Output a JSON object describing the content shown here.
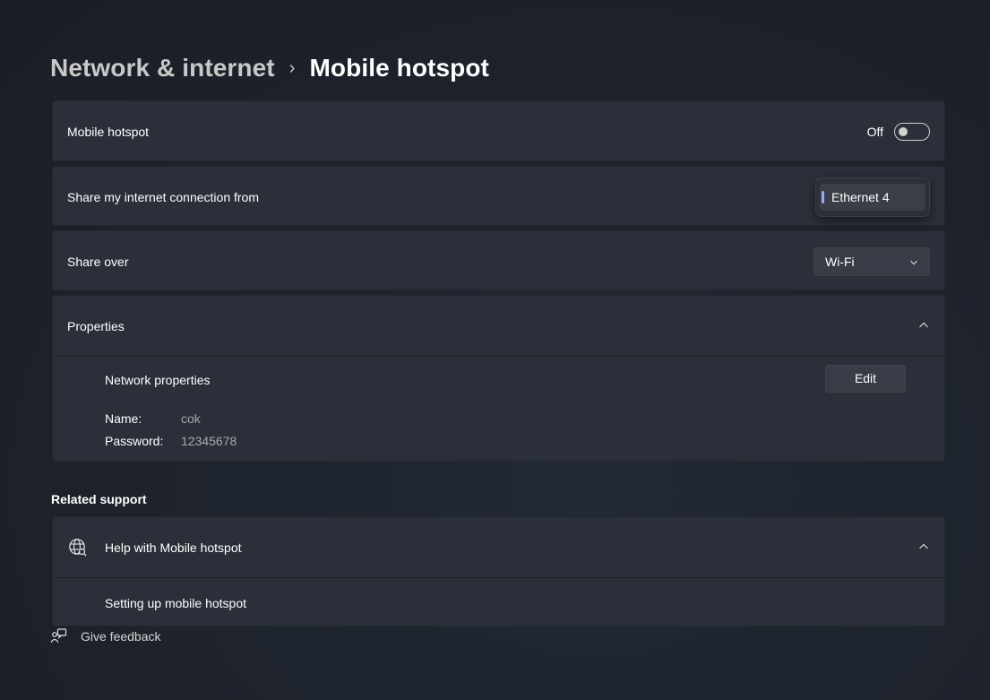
{
  "breadcrumb": {
    "parent": "Network & internet",
    "separator": "›",
    "current": "Mobile hotspot"
  },
  "hotspot": {
    "label": "Mobile hotspot",
    "state_label": "Off",
    "enabled": false
  },
  "share_from": {
    "label": "Share my internet connection from",
    "selected": "Ethernet 4"
  },
  "share_over": {
    "label": "Share over",
    "value": "Wi-Fi"
  },
  "properties": {
    "label": "Properties",
    "expanded": true,
    "network_properties_label": "Network properties",
    "edit_label": "Edit",
    "name_key": "Name:",
    "name_value": "cok",
    "password_key": "Password:",
    "password_value": "12345678"
  },
  "related_support": {
    "heading": "Related support",
    "help_label": "Help with Mobile hotspot",
    "expanded": true,
    "links": [
      "Setting up mobile hotspot"
    ]
  },
  "feedback": {
    "label": "Give feedback"
  },
  "colors": {
    "background": "#1c2029",
    "card": "#2a2f39",
    "accent": "#9aa6ff",
    "secondary_text": "#a7a9ad"
  }
}
